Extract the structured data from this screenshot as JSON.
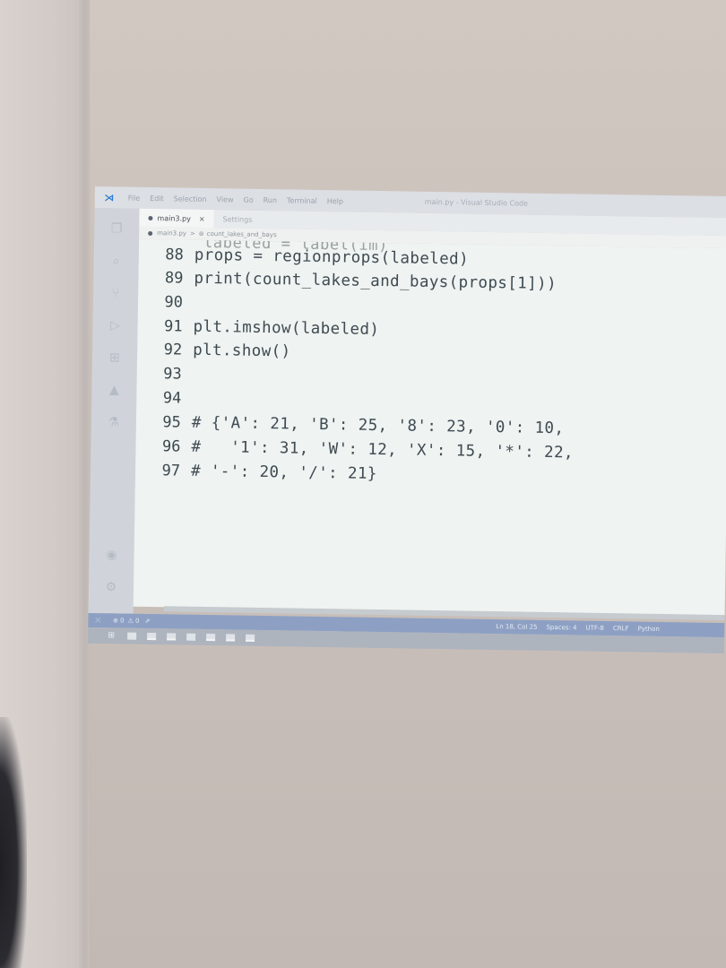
{
  "window": {
    "menu": [
      "File",
      "Edit",
      "Selection",
      "View",
      "Go",
      "Run",
      "Terminal",
      "Help"
    ],
    "title": "main.py - Visual Studio Code"
  },
  "tabs": [
    {
      "label": "main3.py",
      "active": true,
      "close": "×"
    },
    {
      "label": "Settings",
      "active": false
    }
  ],
  "breadcrumb": {
    "file": "main3.py",
    "separator": ">",
    "symbol": "count_lakes_and_bays"
  },
  "editor": {
    "partial_line": "labeled = label(im)",
    "lines": [
      {
        "num": "88",
        "code": "props = regionprops(labeled)"
      },
      {
        "num": "89",
        "code": "print(count_lakes_and_bays(props[1]))"
      },
      {
        "num": "90",
        "code": ""
      },
      {
        "num": "91",
        "code": "plt.imshow(labeled)"
      },
      {
        "num": "92",
        "code": "plt.show()"
      },
      {
        "num": "93",
        "code": ""
      },
      {
        "num": "94",
        "code": ""
      },
      {
        "num": "95",
        "code": "# {'A': 21, 'B': 25, '8': 23, '0': 10,"
      },
      {
        "num": "96",
        "code": "#   '1': 31, 'W': 12, 'X': 15, '*': 22,"
      },
      {
        "num": "97",
        "code": "# '-': 20, '/': 21}"
      }
    ]
  },
  "statusbar": {
    "left": [
      "⊗ 0",
      "⚠ 0"
    ],
    "position": "Ln 18, Col 25",
    "spaces": "Spaces: 4",
    "encoding": "UTF-8",
    "eol": "CRLF",
    "language": "Python"
  },
  "colors": {
    "editor_bg": "#eff3f1",
    "statusbar_bg": "#8da0c4",
    "accent": "#2a7bd3"
  }
}
